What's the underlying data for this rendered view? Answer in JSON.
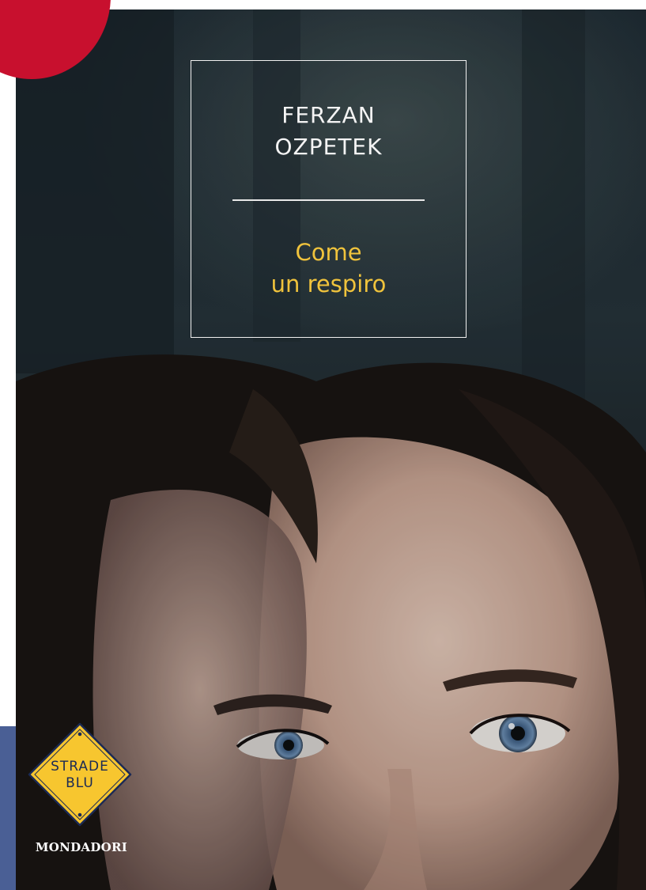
{
  "cover": {
    "author_line_1": "FERZAN",
    "author_line_2": "OZPETEK",
    "title_line_1": "Come",
    "title_line_2": "un respiro",
    "series_badge_line_1": "STRADE",
    "series_badge_line_2": "BLU",
    "publisher": "MONDADORI"
  },
  "colors": {
    "title": "#f0c33c",
    "author": "#f4f4f4",
    "corner_accent": "#c8102e",
    "side_band": "#4a5f95",
    "badge_fill": "#f7c62f",
    "badge_text": "#1b2a55"
  },
  "icons": {
    "badge": "road-sign-diamond-icon"
  }
}
